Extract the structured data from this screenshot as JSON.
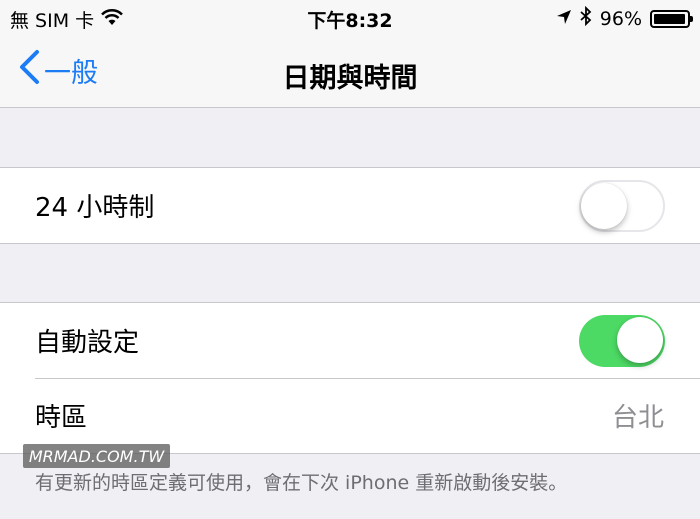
{
  "status_bar": {
    "carrier": "無 SIM 卡",
    "time": "下午8:32",
    "battery_percent": "96%",
    "battery_level": 0.96
  },
  "nav": {
    "back_label": "一般",
    "title": "日期與時間"
  },
  "settings": {
    "hour24": {
      "label": "24 小時制",
      "value": false
    },
    "auto_set": {
      "label": "自動設定",
      "value": true
    },
    "timezone": {
      "label": "時區",
      "value": "台北"
    }
  },
  "footer_note": "有更新的時區定義可使用，會在下次 iPhone 重新啟動後安裝。",
  "watermark": "MRMAD.COM.TW",
  "colors": {
    "accent": "#1b7cf5",
    "toggle_on": "#4cd964",
    "background": "#efeff4"
  }
}
